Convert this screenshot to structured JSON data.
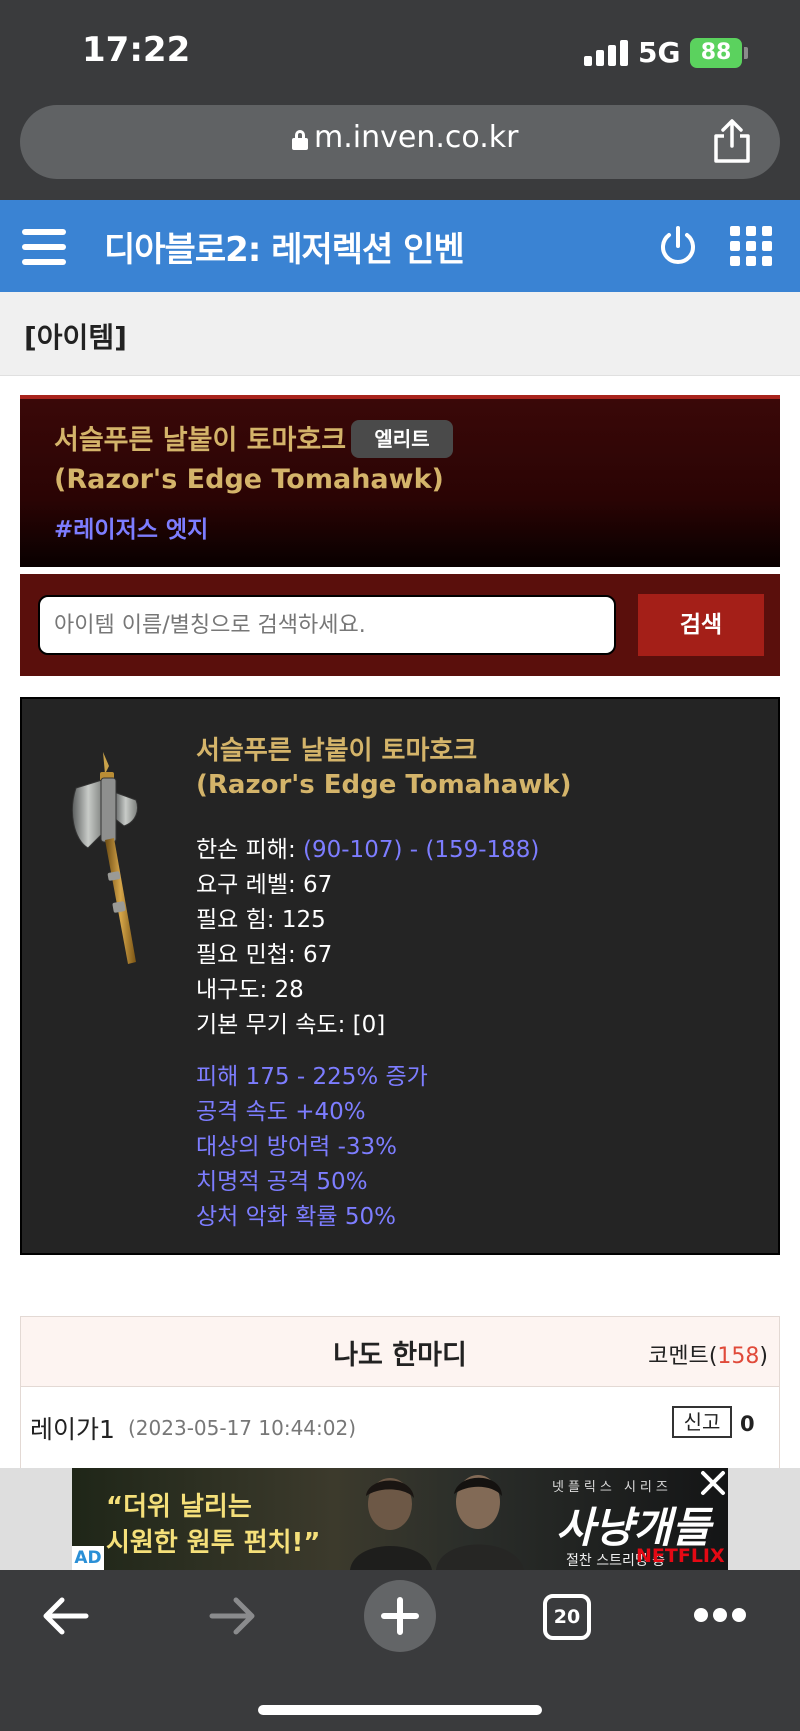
{
  "status_bar": {
    "time": "17:22",
    "network": "5G",
    "battery": "88"
  },
  "browser": {
    "url": "m.inven.co.kr",
    "tab_count": "20"
  },
  "site": {
    "title": "디아블로2: 레저렉션 인벤"
  },
  "category": {
    "title": "[아이템]"
  },
  "item": {
    "name_kr": "서슬푸른 날붙이 토마호크",
    "name_en": "(Razor's Edge Tomahawk)",
    "grade_badge": "엘리트",
    "tag": "#레이저스 엣지",
    "stats": [
      {
        "label": "한손 피해: ",
        "value": "(90-107) - (159-188)",
        "highlight": true
      },
      {
        "label": "요구 레벨: ",
        "value": "67",
        "highlight": false
      },
      {
        "label": "필요 힘: ",
        "value": "125",
        "highlight": false
      },
      {
        "label": "필요 민첩: ",
        "value": "67",
        "highlight": false
      },
      {
        "label": "내구도: ",
        "value": "28",
        "highlight": false
      },
      {
        "label": "기본 무기 속도: ",
        "value": "[0]",
        "highlight": false
      }
    ],
    "magic_properties": [
      "피해 175 - 225% 증가",
      "공격 속도 +40%",
      "대상의 방어력 -33%",
      "치명적 공격 50%",
      "상처 악화 확률 50%"
    ]
  },
  "search": {
    "placeholder": "아이템 이름/별칭으로 검색하세요.",
    "button_label": "검색"
  },
  "comments": {
    "heading": "나도 한마디",
    "count_label": "코멘트",
    "count_open": "(",
    "count": "158",
    "count_close": ")",
    "first": {
      "author": "레이가1",
      "date": "(2023-05-17 10:44:02)",
      "report_label": "신고",
      "report_count": "0"
    }
  },
  "ad": {
    "copy_line1": "“더위 날리는",
    "copy_line2": "시원한 원투 펀치!”",
    "series_label": "넷플릭스 시리즈",
    "show_title": "사냥개들",
    "streaming": "절찬 스트리밍 중",
    "brand": "NETFLIX",
    "badge": "AD"
  },
  "colors": {
    "site_header": "#3a83d3",
    "item_gold": "#d4b46a",
    "magic_blue": "#7d7dff",
    "search_button": "#a41f18"
  }
}
